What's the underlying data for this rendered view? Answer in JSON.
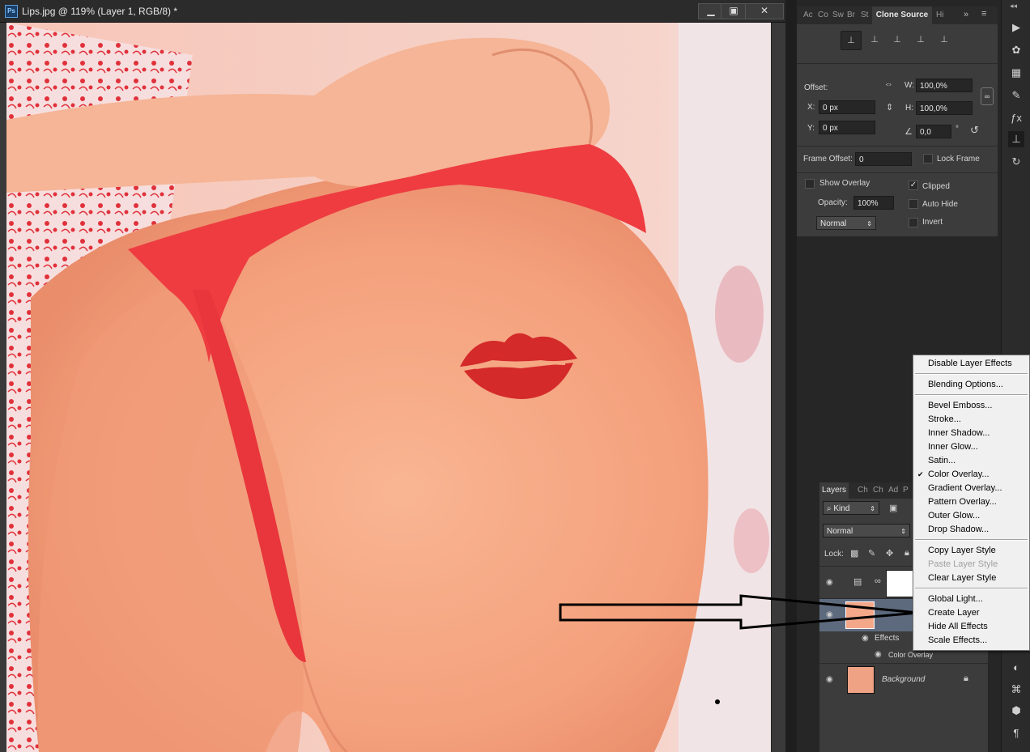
{
  "document": {
    "title": "Lips.jpg @ 119% (Layer 1, RGB/8) *",
    "app_icon": "Ps",
    "window_controls": [
      "minimize-icon",
      "maximize-icon",
      "close-icon"
    ]
  },
  "clone_source_panel": {
    "tabs": [
      "Ac",
      "Co",
      "Sw",
      "Br",
      "St",
      "Clone Source",
      "Hi"
    ],
    "active_tab": "Clone Source",
    "offset_label": "Offset:",
    "x_label": "X:",
    "x_value": "0 px",
    "y_label": "Y:",
    "y_value": "0 px",
    "w_label": "W:",
    "w_value": "100,0%",
    "h_label": "H:",
    "h_value": "100,0%",
    "angle_value": "0,0",
    "degree": "°",
    "frame_offset_label": "Frame Offset:",
    "frame_offset_value": "0",
    "lock_frame_label": "Lock Frame",
    "show_overlay_label": "Show Overlay",
    "clipped_label": "Clipped",
    "opacity_label": "Opacity:",
    "opacity_value": "100%",
    "auto_hide_label": "Auto Hide",
    "blend_value": "Normal",
    "invert_label": "Invert",
    "clipped_checked": true
  },
  "layers_panel": {
    "tabs": [
      "Layers",
      "Ch",
      "Ch",
      "Ad",
      "P"
    ],
    "kind_label": "Kind",
    "blend_mode": "Normal",
    "lock_label": "Lock:",
    "effects_label": "Effects",
    "color_overlay_label": "Color Overlay",
    "background_label": "Background"
  },
  "context_menu": {
    "items": [
      {
        "label": "Disable Layer Effects",
        "enabled": true,
        "checked": false
      },
      {
        "sep": true
      },
      {
        "label": "Blending Options...",
        "enabled": true,
        "checked": false
      },
      {
        "sep": true
      },
      {
        "label": "Bevel  Emboss...",
        "enabled": true,
        "checked": false
      },
      {
        "label": "Stroke...",
        "enabled": true,
        "checked": false
      },
      {
        "label": "Inner Shadow...",
        "enabled": true,
        "checked": false
      },
      {
        "label": "Inner Glow...",
        "enabled": true,
        "checked": false
      },
      {
        "label": "Satin...",
        "enabled": true,
        "checked": false
      },
      {
        "label": "Color Overlay...",
        "enabled": true,
        "checked": true
      },
      {
        "label": "Gradient Overlay...",
        "enabled": true,
        "checked": false
      },
      {
        "label": "Pattern Overlay...",
        "enabled": true,
        "checked": false
      },
      {
        "label": "Outer Glow...",
        "enabled": true,
        "checked": false
      },
      {
        "label": "Drop Shadow...",
        "enabled": true,
        "checked": false
      },
      {
        "sep": true
      },
      {
        "label": "Copy Layer Style",
        "enabled": true,
        "checked": false
      },
      {
        "label": "Paste Layer Style",
        "enabled": false,
        "checked": false
      },
      {
        "label": "Clear Layer Style",
        "enabled": true,
        "checked": false
      },
      {
        "sep": true
      },
      {
        "label": "Global Light...",
        "enabled": true,
        "checked": false
      },
      {
        "label": "Create Layer",
        "enabled": true,
        "checked": false
      },
      {
        "label": "Hide All Effects",
        "enabled": true,
        "checked": false
      },
      {
        "label": "Scale Effects...",
        "enabled": true,
        "checked": false
      }
    ],
    "check_glyph": "✔"
  },
  "colors": {
    "skin": "#f6a883",
    "lips": "#d42a2a",
    "fabric": "#ef3a3e"
  }
}
